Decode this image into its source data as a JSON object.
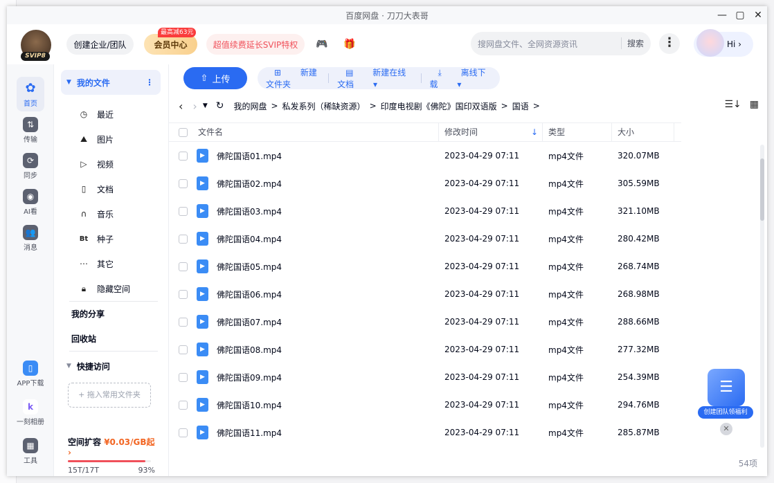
{
  "window": {
    "title": "百度网盘 · 刀刀大表哥"
  },
  "header": {
    "svip_level": "SVIP8",
    "enterprise_btn": "创建企业/团队",
    "member_btn": "会员中心",
    "member_badge": "最高减63元",
    "renew_btn": "超值续费延长SVIP特权",
    "search_placeholder": "搜网盘文件、全网资源资讯",
    "search_btn": "搜索",
    "more": "⋮",
    "hi": "Hi ›"
  },
  "leftbar": {
    "items": [
      {
        "label": "首页",
        "icon": "home-icon"
      },
      {
        "label": "传输",
        "icon": "transfer-icon"
      },
      {
        "label": "同步",
        "icon": "sync-icon"
      },
      {
        "label": "AI看",
        "icon": "ai-icon"
      },
      {
        "label": "消息",
        "icon": "message-icon"
      }
    ],
    "bottom": [
      {
        "label": "APP下载"
      },
      {
        "label": "一刻相册"
      },
      {
        "label": "工具"
      }
    ]
  },
  "nav": {
    "my_files": "我的文件",
    "items": [
      "最近",
      "图片",
      "视频",
      "文档",
      "音乐",
      "种子",
      "其它",
      "隐藏空间"
    ],
    "my_share": "我的分享",
    "recycle": "回收站",
    "quick_access": "快捷访问",
    "drop_hint": "+ 拖入常用文件夹",
    "quota_label": "空间扩容",
    "quota_price": "¥0.03/GB起",
    "quota_used": "15T/17T",
    "quota_percent": "93%",
    "quota_fraction": 0.93
  },
  "toolbar": {
    "upload": "上传",
    "new_folder": "新建文件夹",
    "new_doc": "新建在线文档",
    "offline": "离线下载"
  },
  "breadcrumb": [
    "我的网盘",
    "私发系列（稀缺资源）",
    "印度电视剧《佛陀》国印双语版",
    "国语"
  ],
  "table": {
    "headers": [
      "文件名",
      "修改时间",
      "类型",
      "大小"
    ],
    "rows": [
      {
        "name": "佛陀国语01.mp4",
        "time": "2023-04-29 07:11",
        "type": "mp4文件",
        "size": "320.07MB"
      },
      {
        "name": "佛陀国语02.mp4",
        "time": "2023-04-29 07:11",
        "type": "mp4文件",
        "size": "305.59MB"
      },
      {
        "name": "佛陀国语03.mp4",
        "time": "2023-04-29 07:11",
        "type": "mp4文件",
        "size": "321.10MB"
      },
      {
        "name": "佛陀国语04.mp4",
        "time": "2023-04-29 07:11",
        "type": "mp4文件",
        "size": "280.42MB"
      },
      {
        "name": "佛陀国语05.mp4",
        "time": "2023-04-29 07:11",
        "type": "mp4文件",
        "size": "268.74MB"
      },
      {
        "name": "佛陀国语06.mp4",
        "time": "2023-04-29 07:11",
        "type": "mp4文件",
        "size": "268.98MB"
      },
      {
        "name": "佛陀国语07.mp4",
        "time": "2023-04-29 07:11",
        "type": "mp4文件",
        "size": "288.66MB"
      },
      {
        "name": "佛陀国语08.mp4",
        "time": "2023-04-29 07:11",
        "type": "mp4文件",
        "size": "277.32MB"
      },
      {
        "name": "佛陀国语09.mp4",
        "time": "2023-04-29 07:11",
        "type": "mp4文件",
        "size": "254.39MB"
      },
      {
        "name": "佛陀国语10.mp4",
        "time": "2023-04-29 07:11",
        "type": "mp4文件",
        "size": "294.76MB"
      },
      {
        "name": "佛陀国语11.mp4",
        "time": "2023-04-29 07:11",
        "type": "mp4文件",
        "size": "285.87MB"
      }
    ]
  },
  "promo": "创建团队领福利",
  "count": "54项"
}
